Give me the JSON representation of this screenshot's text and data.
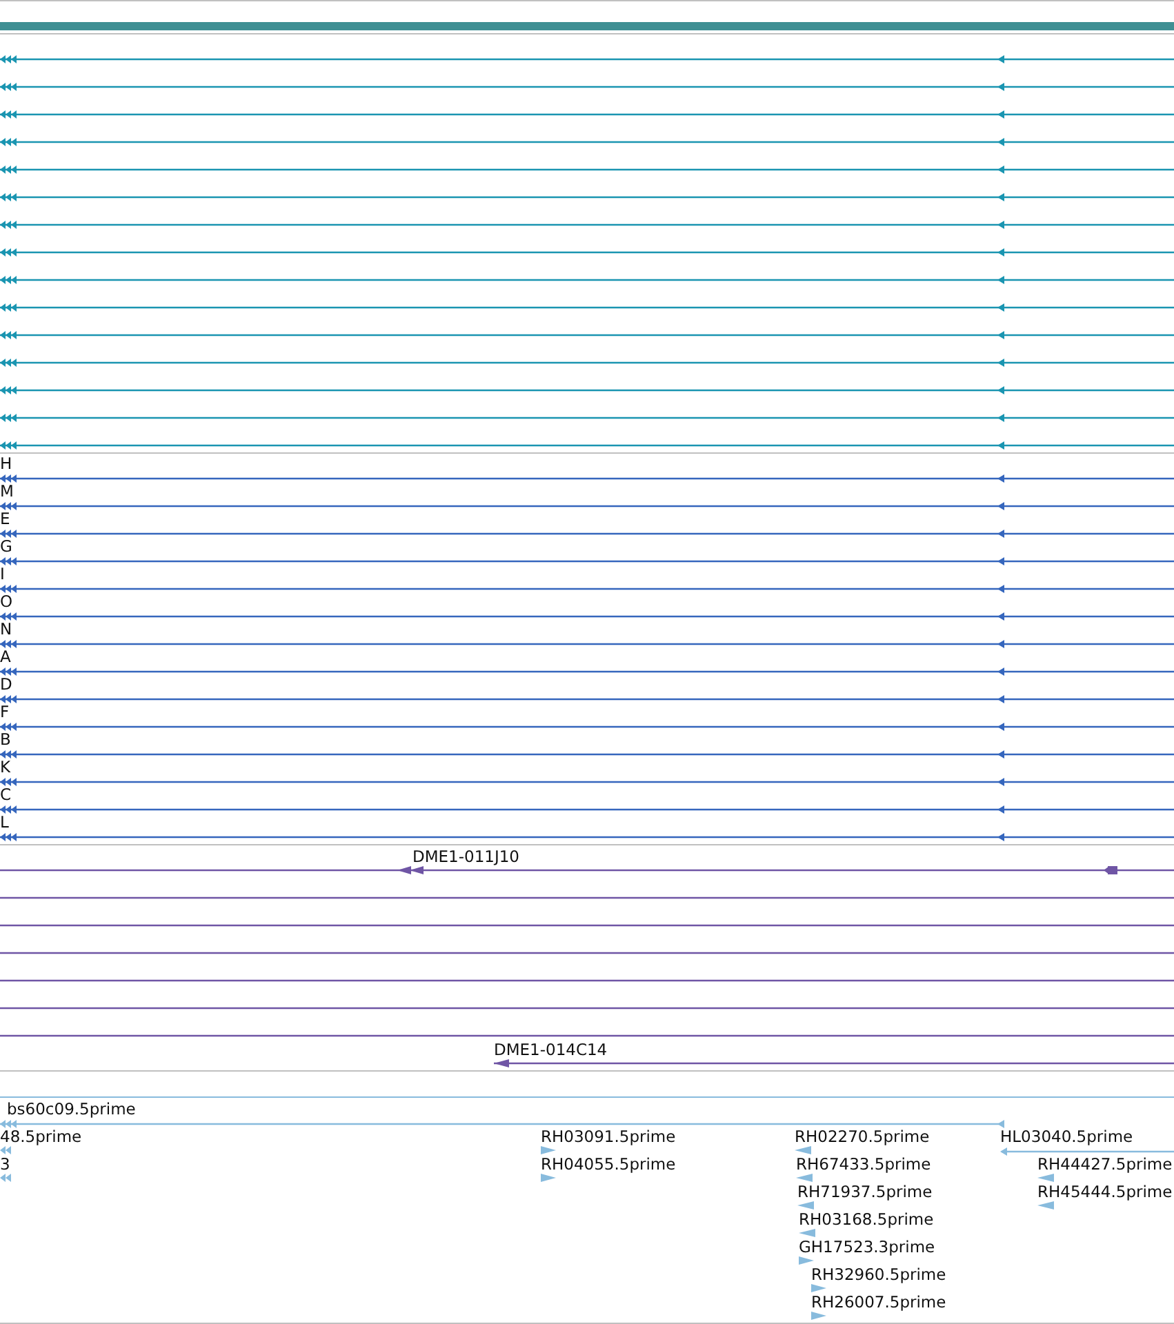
{
  "tracks": [
    {
      "kind": "transcripts",
      "color": "#1a95b1",
      "rows": [
        {
          "kind": "plain"
        },
        {
          "kind": "plain"
        },
        {
          "kind": "plain"
        },
        {
          "kind": "plain"
        },
        {
          "kind": "plain"
        },
        {
          "kind": "plain"
        },
        {
          "kind": "plain"
        },
        {
          "kind": "plain"
        },
        {
          "kind": "plain"
        },
        {
          "kind": "plain"
        },
        {
          "kind": "plain"
        },
        {
          "kind": "plain"
        },
        {
          "kind": "plain"
        },
        {
          "kind": "plain"
        },
        {
          "kind": "plain"
        }
      ]
    },
    {
      "kind": "transcripts",
      "color": "#3566bd",
      "rows": [
        {
          "kind": "labeled",
          "label": "H"
        },
        {
          "kind": "labeled",
          "label": "M"
        },
        {
          "kind": "labeled",
          "label": "E"
        },
        {
          "kind": "labeled",
          "label": "G"
        },
        {
          "kind": "labeled",
          "label": "I"
        },
        {
          "kind": "labeled",
          "label": "O"
        },
        {
          "kind": "labeled",
          "label": "N"
        },
        {
          "kind": "labeled",
          "label": "A"
        },
        {
          "kind": "labeled",
          "label": "D"
        },
        {
          "kind": "labeled",
          "label": "F"
        },
        {
          "kind": "labeled",
          "label": "B"
        },
        {
          "kind": "labeled",
          "label": "K"
        },
        {
          "kind": "labeled",
          "label": "C"
        },
        {
          "kind": "labeled",
          "label": "L"
        }
      ]
    },
    {
      "kind": "clones",
      "color": "#6f55a5",
      "rows": [
        {
          "kind": "labeled",
          "label": "DME1-011J10"
        },
        {
          "kind": "plain"
        },
        {
          "kind": "plain"
        },
        {
          "kind": "plain"
        },
        {
          "kind": "plain"
        },
        {
          "kind": "plain"
        },
        {
          "kind": "plain"
        },
        {
          "kind": "labeled",
          "label": "DME1-014C14"
        }
      ]
    },
    {
      "kind": "ests",
      "color": "#88bbdd",
      "features": [
        {
          "label": "bs60c09.5prime",
          "reverse": true
        },
        {
          "label": "48.5prime",
          "reverse": true
        },
        {
          "label": "3",
          "reverse": true
        },
        {
          "label": "RH03091.5prime",
          "reverse": false
        },
        {
          "label": "RH04055.5prime",
          "reverse": false
        },
        {
          "label": "RH02270.5prime",
          "reverse": true
        },
        {
          "label": "RH67433.5prime",
          "reverse": true
        },
        {
          "label": "RH71937.5prime",
          "reverse": true
        },
        {
          "label": "RH03168.5prime",
          "reverse": true
        },
        {
          "label": "GH17523.3prime",
          "reverse": false
        },
        {
          "label": "RH32960.5prime",
          "reverse": false
        },
        {
          "label": "RH26007.5prime",
          "reverse": false
        },
        {
          "label": "HL03040.5prime",
          "reverse": true
        },
        {
          "label": "RH44427.5prime",
          "reverse": true
        },
        {
          "label": "RH45444.5prime",
          "reverse": true
        }
      ]
    }
  ]
}
